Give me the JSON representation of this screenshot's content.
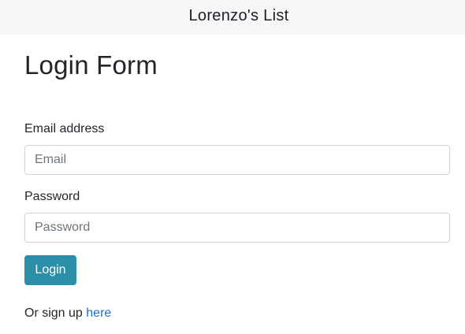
{
  "navbar": {
    "brand": "Lorenzo's List"
  },
  "page": {
    "title": "Login Form"
  },
  "form": {
    "email_label": "Email address",
    "email_placeholder": "Email",
    "email_value": "",
    "password_label": "Password",
    "password_placeholder": "Password",
    "password_value": "",
    "submit_label": "Login"
  },
  "footer": {
    "signup_prefix": "Or sign up ",
    "signup_link": "here"
  },
  "colors": {
    "navbar_bg": "#f5f6f8",
    "button_bg": "#2b8fa8",
    "link": "#1a6fd8"
  }
}
